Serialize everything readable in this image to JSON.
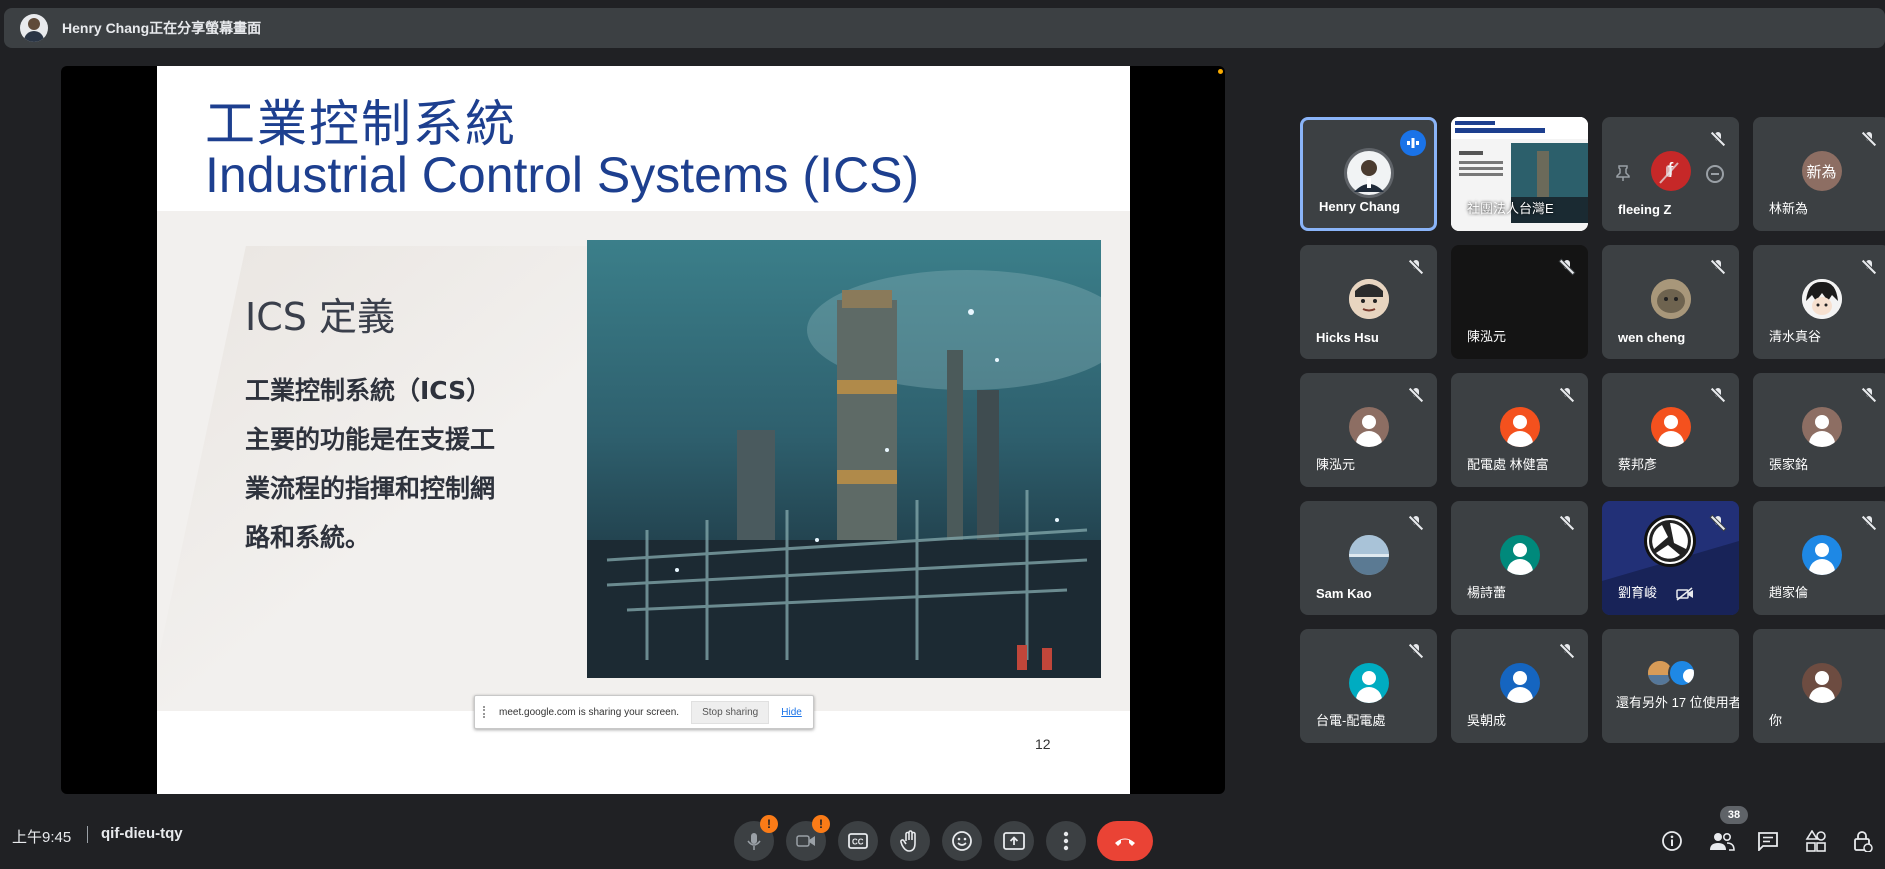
{
  "banner": {
    "text": "Henry Chang正在分享螢幕畫面"
  },
  "slide": {
    "title_zh": "工業控制系統",
    "title_en": "Industrial Control Systems (ICS)",
    "heading": "ICS 定義",
    "body": "工業控制系統（ICS）\n主要的功能是在支援工\n業流程的指揮和控制網\n路和系統。",
    "page_number": "12"
  },
  "share_notice": {
    "text": "meet.google.com is sharing your screen.",
    "stop_label": "Stop sharing",
    "hide_label": "Hide"
  },
  "participants": [
    {
      "name": "Henry Chang"
    },
    {
      "name": "社團法人台灣E"
    },
    {
      "name": "fleeing Z",
      "initial": "f"
    },
    {
      "name": "林新為",
      "initial": "新為"
    },
    {
      "name": "Hicks Hsu"
    },
    {
      "name": "陳泓元"
    },
    {
      "name": "wen cheng"
    },
    {
      "name": "清水真谷"
    },
    {
      "name": "陳泓元"
    },
    {
      "name": "配電處 林健富"
    },
    {
      "name": "蔡邦彥"
    },
    {
      "name": "張家銘"
    },
    {
      "name": "Sam Kao"
    },
    {
      "name": "楊詩蕾"
    },
    {
      "name": "劉育峻"
    },
    {
      "name": "趙家倫"
    },
    {
      "name": "台電-配電處"
    },
    {
      "name": "吳朝成"
    },
    {
      "name": "還有另外 17 位使用者"
    },
    {
      "name": "你"
    }
  ],
  "bottom": {
    "time": "上午9:45",
    "meeting_code": "qif-dieu-tqy",
    "warn_symbol": "!",
    "participant_count": "38"
  },
  "icons": {
    "mic": "mic-off-icon",
    "camera": "videocam-off-icon",
    "captions": "closed-caption-icon",
    "hand": "raise-hand-icon",
    "emoji": "emoji-icon",
    "present": "present-screen-icon",
    "more": "more-vert-icon",
    "hangup": "call-end-icon",
    "info": "info-icon",
    "people": "people-icon",
    "chat": "chat-icon",
    "activities": "activities-icon",
    "host": "host-controls-icon"
  },
  "colors": {
    "background": "#202124",
    "tile": "#3c4043",
    "active_border": "#8ab4f8",
    "hangup": "#ea4335",
    "warning": "#fa7b17"
  }
}
